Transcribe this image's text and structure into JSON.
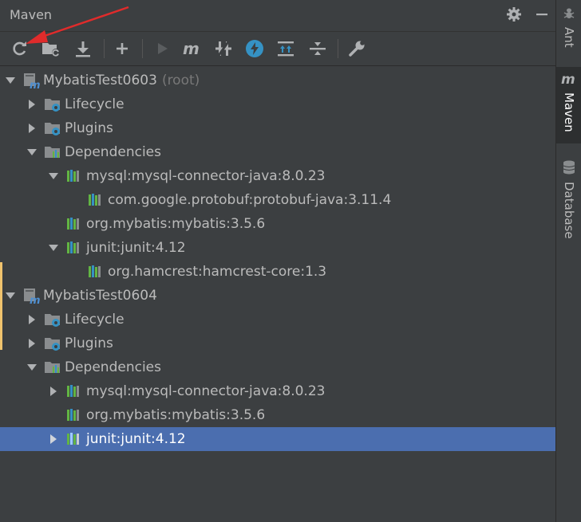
{
  "panel": {
    "title": "Maven"
  },
  "toolbar": {
    "buttons": [
      {
        "name": "reload-all-maven-projects",
        "icon": "refresh-icon"
      },
      {
        "name": "generate-sources",
        "icon": "folder-refresh-icon"
      },
      {
        "name": "download-sources",
        "icon": "download-icon"
      },
      {
        "name": "add-maven-project",
        "icon": "plus-icon"
      },
      {
        "name": "run-maven-build",
        "icon": "run-icon"
      },
      {
        "name": "execute-maven-goal",
        "icon": "maven-m-icon"
      },
      {
        "name": "toggle-offline-mode",
        "icon": "offline-icon"
      },
      {
        "name": "skip-tests",
        "icon": "lightning-icon"
      },
      {
        "name": "show-dependencies",
        "icon": "expand-all-icon"
      },
      {
        "name": "collapse-all",
        "icon": "collapse-all-icon"
      },
      {
        "name": "maven-settings",
        "icon": "wrench-icon"
      }
    ]
  },
  "tree": {
    "rows": [
      {
        "label": "MybatisTest0603",
        "suffix": "(root)"
      },
      {
        "label": "Lifecycle"
      },
      {
        "label": "Plugins"
      },
      {
        "label": "Dependencies"
      },
      {
        "label": "mysql:mysql-connector-java:8.0.23"
      },
      {
        "label": "com.google.protobuf:protobuf-java:3.11.4"
      },
      {
        "label": "org.mybatis:mybatis:3.5.6"
      },
      {
        "label": "junit:junit:4.12"
      },
      {
        "label": "org.hamcrest:hamcrest-core:1.3"
      },
      {
        "label": "MybatisTest0604"
      },
      {
        "label": "Lifecycle"
      },
      {
        "label": "Plugins"
      },
      {
        "label": "Dependencies"
      },
      {
        "label": "mysql:mysql-connector-java:8.0.23"
      },
      {
        "label": "org.mybatis:mybatis:3.5.6"
      },
      {
        "label": "junit:junit:4.12",
        "selected": true
      }
    ]
  },
  "side_tabs": [
    {
      "label": "Ant",
      "icon": "ant-icon"
    },
    {
      "label": "Maven",
      "icon": "maven-m-icon",
      "active": true
    },
    {
      "label": "Database",
      "icon": "database-icon"
    }
  ],
  "colors": {
    "background": "#3c3f41",
    "selection": "#4b6eaf",
    "annotation_arrow": "#e02b2b",
    "module_icon": "#4e8fd1",
    "dependency_icon": "#62b543"
  }
}
